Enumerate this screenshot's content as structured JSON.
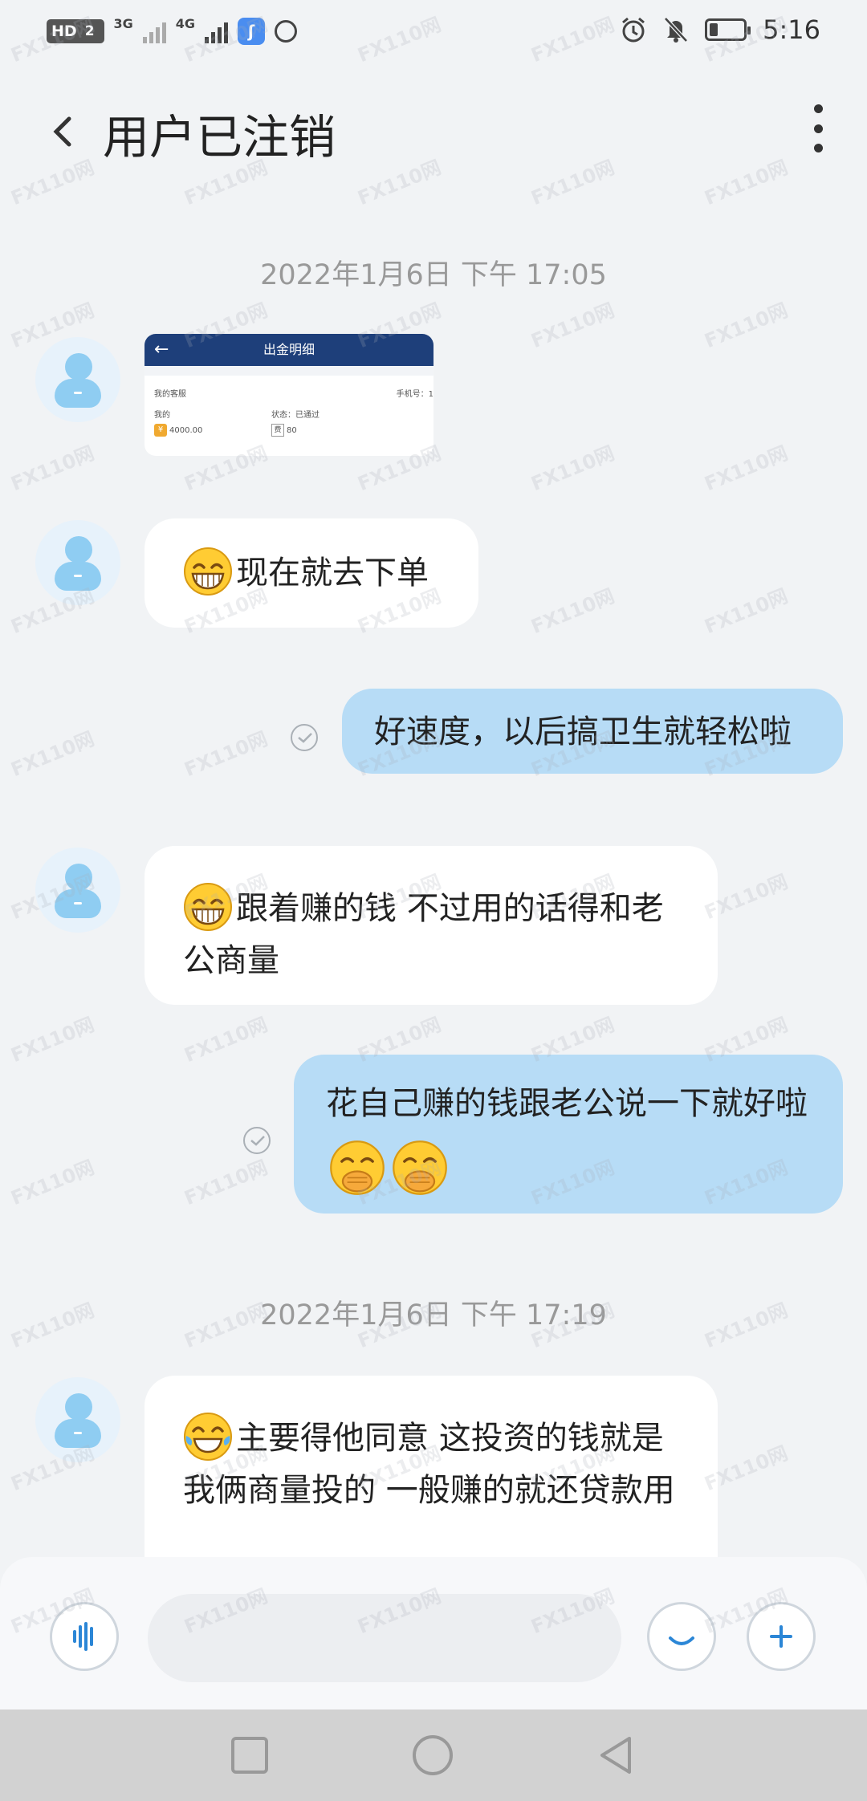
{
  "status_bar": {
    "hd": "HD",
    "sim": "2",
    "net1": "3G",
    "net2": "4G",
    "time": "5:16"
  },
  "header": {
    "title": "用户已注销",
    "back_icon": "chevron-left-icon",
    "more_icon": "more-vertical-icon"
  },
  "chat": {
    "timestamps": [
      "2022年1月6日 下午 17:05",
      "2022年1月6日 下午 17:19"
    ],
    "image_message": {
      "title": "出金明细",
      "left_label": "我的客服",
      "right_label": "手机号：1",
      "account_label": "我的",
      "status": "状态：已通过",
      "amount": "4000.00",
      "fee": "80"
    },
    "messages": [
      {
        "side": "in",
        "emoji": "grinning-face",
        "text": "现在就去下单"
      },
      {
        "side": "out",
        "text": "好速度，以后搞卫生就轻松啦"
      },
      {
        "side": "in",
        "emoji": "grinning-face",
        "text": "跟着赚的钱 不过用的话得和老公商量"
      },
      {
        "side": "out",
        "text": "花自己赚的钱跟老公说一下就好啦",
        "emoji_after": [
          "face-with-hand-over-mouth",
          "face-with-hand-over-mouth"
        ]
      },
      {
        "side": "in",
        "emoji": "tears-of-joy-face",
        "text": "主要得他同意 这投资的钱就是我俩商量投的 一般赚的就还贷款用"
      }
    ]
  },
  "input_bar": {
    "voice_icon": "voice-icon",
    "placeholder": "",
    "emoji_icon": "emoji-icon",
    "add_icon": "plus-icon"
  },
  "nav_bar": {
    "recent_icon": "square-icon",
    "home_icon": "circle-icon",
    "back_icon": "triangle-back-icon"
  },
  "watermark": "FX110网",
  "colors": {
    "background": "#f1f3f5",
    "incoming_bubble": "#ffffff",
    "outgoing_bubble": "#b7dcf6",
    "accent": "#2b86d6"
  }
}
